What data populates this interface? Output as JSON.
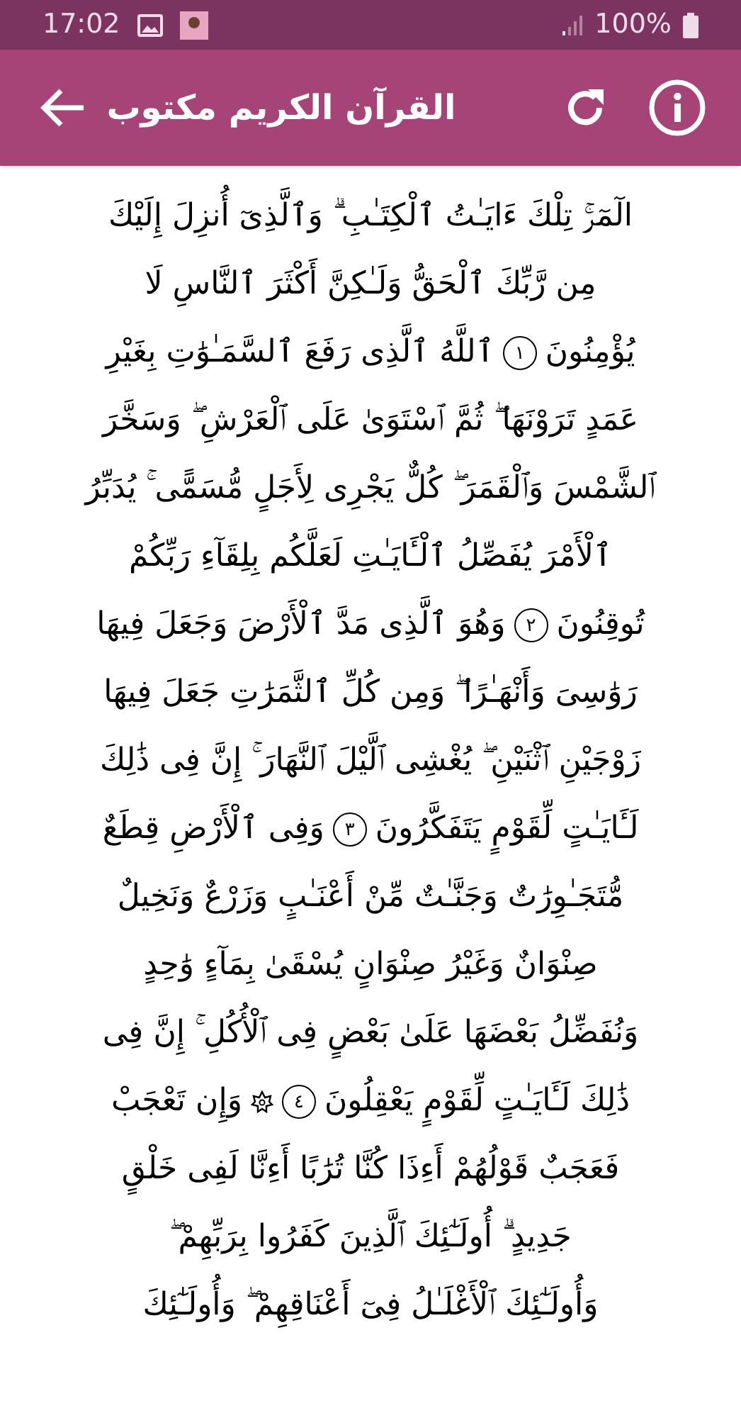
{
  "status_bar": {
    "time": "17:02",
    "battery": "100%"
  },
  "app_bar": {
    "title": "القرآن الكريم مكتوب"
  },
  "lines": [
    [
      {
        "kind": "text",
        "text": "الٓمٓرۚ تِلْكَ ءَايَـٰتُ ٱلْكِتَـٰبِ ۗ وَٱلَّذِىٓ أُنزِلَ إِلَيْكَ"
      }
    ],
    [
      {
        "kind": "text",
        "text": "مِن رَّبِّكَ ٱلْحَقُّ وَلَـٰكِنَّ أَكْثَرَ ٱلنَّاسِ لَا"
      }
    ],
    [
      {
        "kind": "text",
        "text": "يُؤْمِنُونَ"
      },
      {
        "kind": "number",
        "text": "١"
      },
      {
        "kind": "text",
        "text": "ٱللَّهُ ٱلَّذِى رَفَعَ ٱلسَّمَـٰوَٰتِ بِغَيْرِ"
      }
    ],
    [
      {
        "kind": "text",
        "text": "عَمَدٍ تَرَوْنَهَا ۖ ثُمَّ ٱسْتَوَىٰ عَلَى ٱلْعَرْشِ ۖ وَسَخَّرَ"
      }
    ],
    [
      {
        "kind": "text",
        "text": "ٱلشَّمْسَ وَٱلْقَمَرَ ۖ كُلٌّ يَجْرِى لِأَجَلٍ مُّسَمًّى ۚ يُدَبِّرُ"
      }
    ],
    [
      {
        "kind": "text",
        "text": "ٱلْأَمْرَ يُفَصِّلُ ٱلْـَٔايَـٰتِ لَعَلَّكُم بِلِقَآءِ رَبِّكُمْ"
      }
    ],
    [
      {
        "kind": "text",
        "text": "تُوقِنُونَ"
      },
      {
        "kind": "number",
        "text": "٢"
      },
      {
        "kind": "text",
        "text": "وَهُوَ ٱلَّذِى مَدَّ ٱلْأَرْضَ وَجَعَلَ فِيهَا"
      }
    ],
    [
      {
        "kind": "text",
        "text": "رَوَٰسِىَ وَأَنْهَـٰرًا ۖ وَمِن كُلِّ ٱلثَّمَرَٰتِ جَعَلَ فِيهَا"
      }
    ],
    [
      {
        "kind": "text",
        "text": "زَوْجَيْنِ ٱثْنَيْنِ ۖ يُغْشِى ٱلَّيْلَ ٱلنَّهَارَ ۚ إِنَّ فِى ذَٰلِكَ"
      }
    ],
    [
      {
        "kind": "text",
        "text": "لَـَٔايَـٰتٍ لِّقَوْمٍ يَتَفَكَّرُونَ"
      },
      {
        "kind": "number",
        "text": "٣"
      },
      {
        "kind": "text",
        "text": "وَفِى ٱلْأَرْضِ قِطَعٌ"
      }
    ],
    [
      {
        "kind": "text",
        "text": "مُّتَجَـٰوِرَٰتٌ وَجَنَّـٰتٌ مِّنْ أَعْنَـٰبٍ وَزَرْعٌ وَنَخِيلٌ"
      }
    ],
    [
      {
        "kind": "text",
        "text": "صِنْوَانٌ وَغَيْرُ صِنْوَانٍ يُسْقَىٰ بِمَآءٍ وَٰحِدٍ"
      }
    ],
    [
      {
        "kind": "text",
        "text": "وَنُفَضِّلُ بَعْضَهَا عَلَىٰ بَعْضٍ فِى ٱلْأُكُلِ ۚ إِنَّ فِى"
      }
    ],
    [
      {
        "kind": "text",
        "text": "ذَٰلِكَ لَـَٔايَـٰتٍ لِّقَوْمٍ يَعْقِلُونَ"
      },
      {
        "kind": "number",
        "text": "٤"
      },
      {
        "kind": "mark"
      },
      {
        "kind": "text",
        "text": "وَإِن تَعْجَبْ"
      }
    ],
    [
      {
        "kind": "text",
        "text": "فَعَجَبٌ قَوْلُهُمْ أَءِذَا كُنَّا تُرَٰبًا أَءِنَّا لَفِى خَلْقٍ"
      }
    ],
    [
      {
        "kind": "text",
        "text": "جَدِيدٍ ۗ أُولَـٰٓئِكَ ٱلَّذِينَ كَفَرُوا بِرَبِّهِمْ ۖ"
      }
    ],
    [
      {
        "kind": "text",
        "text": "وَأُولَـٰٓئِكَ ٱلْأَغْلَـٰلُ فِىٓ أَعْنَاقِهِمْ ۖ وَأُولَـٰٓئِكَ"
      }
    ]
  ]
}
